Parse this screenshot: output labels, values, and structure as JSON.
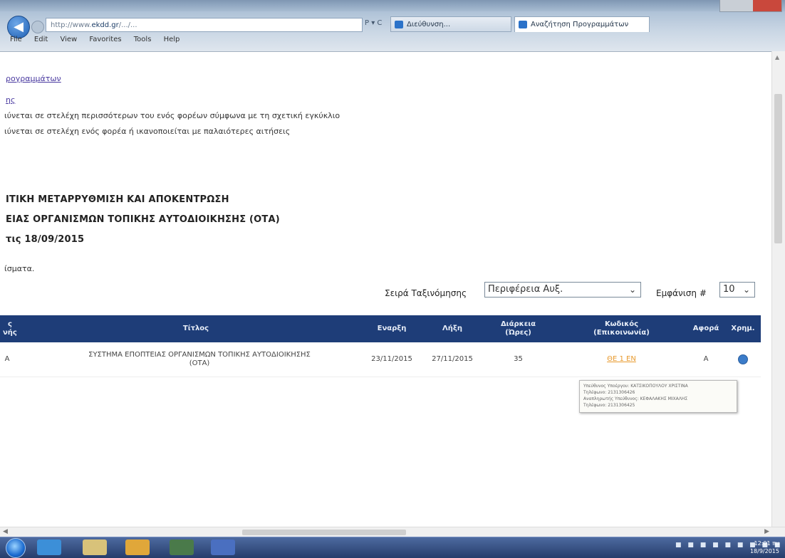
{
  "browser": {
    "address_prefix": "http://www.",
    "address_domain": "ekdd.gr",
    "address_rest": "/.../...",
    "address_tools": "P ▾ C",
    "tabs": [
      {
        "label": "Διεύθυνση..."
      },
      {
        "label": "Αναζήτηση Προγραμμάτων"
      }
    ],
    "menu": [
      "File",
      "Edit",
      "View",
      "Favorites",
      "Tools",
      "Help"
    ]
  },
  "page": {
    "link1": "ρογραμμάτων",
    "link2": "ης",
    "note1": "ιύνεται σε στελέχη περισσότερων του ενός φορέων σύμφωνα με τη σχετική εγκύκλιο",
    "note2": "ιύνεται σε στελέχη ενός φορέα ή ικανοποιείται με παλαιότερες αιτήσεις",
    "heading1": "ΙΤΙΚΗ ΜΕΤΑΡΡΥΘΜΙΣΗ ΚΑΙ ΑΠΟΚΕΝΤΡΩΣΗ",
    "heading2": "ΕΙΑΣ ΟΡΓΑΝΙΣΜΩΝ ΤΟΠΙΚΗΣ ΑΥΤΟΔΙΟΙΚΗΣΗΣ (ΟΤΑ)",
    "heading3": "τις 18/09/2015",
    "snippet": "ίσματα."
  },
  "controls": {
    "sort_label": "Σειρά Ταξινόμησης",
    "sort_value": "Περιφέρεια Αυξ.",
    "show_label": "Εμφάνιση #",
    "show_value": "10"
  },
  "table": {
    "headers": {
      "col0": "ς\nνής",
      "title": "Τίτλος",
      "start": "Εναρξη",
      "end": "Λήξη",
      "duration": "Διάρκεια\n(Ώρες)",
      "code": "Κωδικός\n(Επικοινωνία)",
      "concerns": "Αφορά",
      "info": "Χρημ."
    },
    "rows": [
      {
        "col0": "Α",
        "title": "ΣΥΣΤΗΜΑ ΕΠΟΠΤΕΙΑΣ ΟΡΓΑΝΙΣΜΩΝ ΤΟΠΙΚΗΣ ΑΥΤΟΔΙΟΙΚΗΣΗΣ (ΟΤΑ)",
        "start": "23/11/2015",
        "end": "27/11/2015",
        "duration": "35",
        "code": "ΘΕ 1 ΕΝ",
        "concerns": "Α"
      }
    ],
    "tooltip": [
      "Υπεύθυνος Υποέργου: ΚΑΤΣΙΚΟΠΟΥΛΟΥ ΧΡΙΣΤΙΝΑ",
      "Τηλέφωνο: 2131306426",
      "Αναπληρωτής Υπεύθυνος: ΚΕΦΑΛΑΚΗΣ ΜΙΧΑΛΗΣ",
      "Τηλέφωνο: 2131306425"
    ]
  },
  "taskbar": {
    "clock_time": "12:01 πμ",
    "clock_date": "18/9/2015"
  },
  "colors": {
    "table_header": "#1e3d78",
    "code_link": "#e89a2e",
    "taskbar": "#263d6b"
  }
}
